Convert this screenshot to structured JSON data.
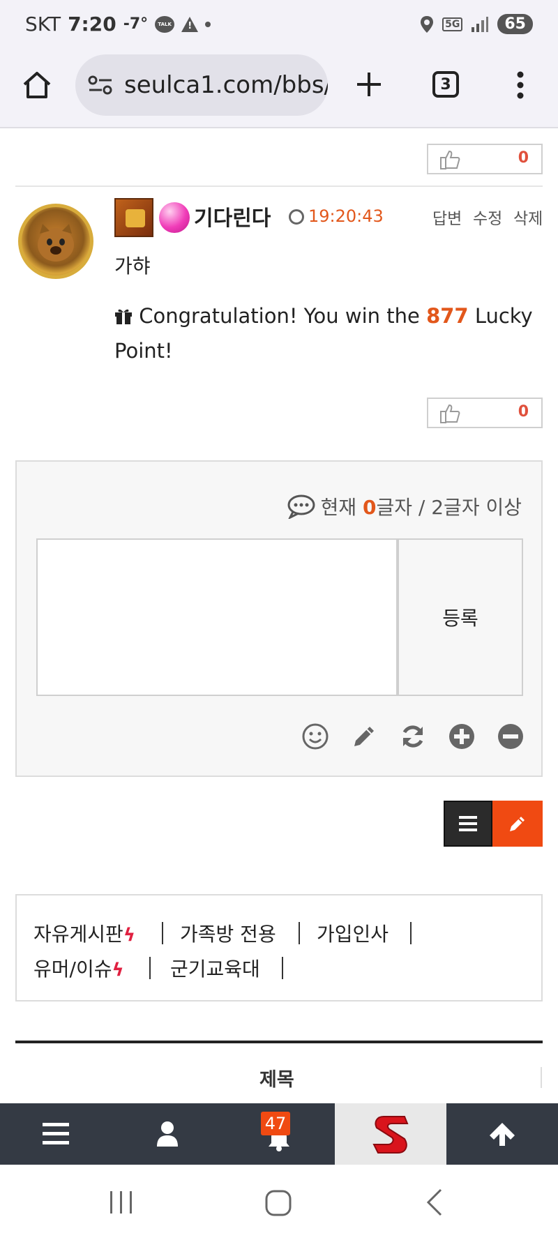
{
  "status_bar": {
    "carrier": "SKT",
    "time": "7:20",
    "temperature": "-7°",
    "talk_label": "TALK",
    "network": "5G",
    "battery": "65"
  },
  "browser": {
    "url": "seulca1.com/bbs/",
    "tab_count": "3"
  },
  "likes": {
    "top_count": "0",
    "comment_count": "0"
  },
  "comment": {
    "nickname": "기다린다",
    "time": "19:20:43",
    "actions": [
      "답변",
      "수정",
      "삭제"
    ],
    "text": "가햐",
    "lucky_prefix": "Congratulation! You win the ",
    "lucky_points": "877",
    "lucky_suffix": " Lucky Point!"
  },
  "form": {
    "counter_prefix": "현재 ",
    "counter_current": "0",
    "counter_suffix": "글자 / 2글자 이상",
    "submit_label": "등록"
  },
  "board_links": [
    {
      "label": "자유게시판",
      "hot": true
    },
    {
      "label": "가족방 전용",
      "hot": false
    },
    {
      "label": "가입인사",
      "hot": false
    },
    {
      "label": "유머/이슈",
      "hot": true
    },
    {
      "label": "군기교육대",
      "hot": false
    }
  ],
  "table": {
    "title_header": "제목"
  },
  "bottom_nav": {
    "notification_count": "47",
    "logo_letter": "S"
  },
  "colors": {
    "accent": "#e2571b",
    "write_button": "#f04a12",
    "nav_bg": "#343a44"
  }
}
